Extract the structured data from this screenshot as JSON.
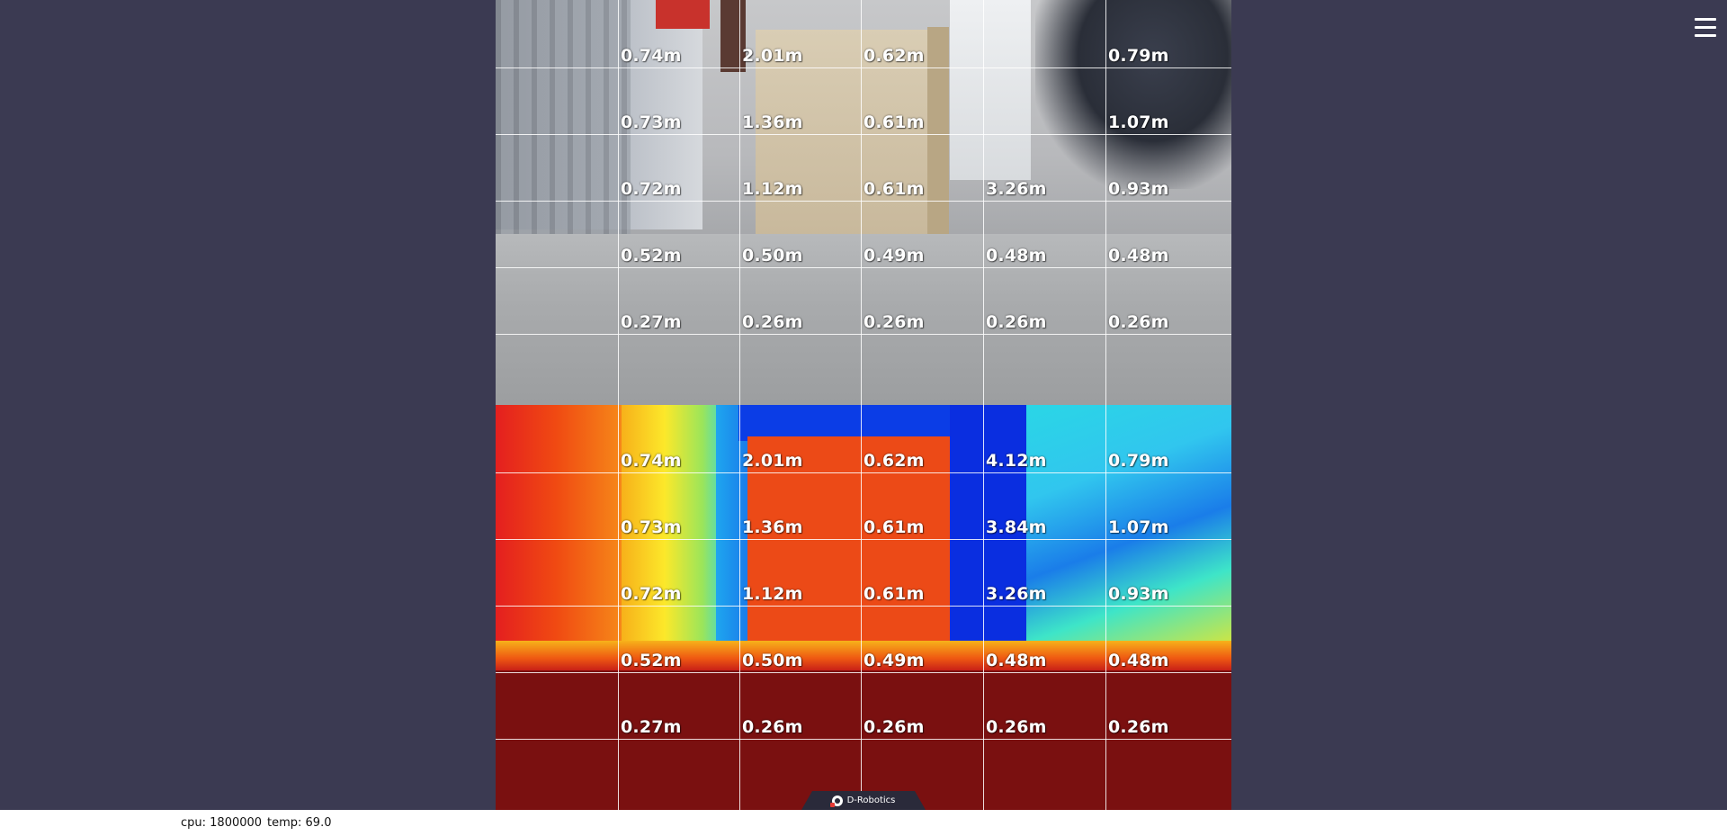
{
  "menu": {
    "icon": "hamburger-menu-icon"
  },
  "brand": {
    "name": "D-Robotics",
    "icon": "d-robotics-logo-icon"
  },
  "status": {
    "cpu": "cpu: 1800000",
    "temp": "temp: 69.0"
  },
  "camera": {
    "rows": [
      [
        "0.74m",
        "2.01m",
        "0.62m",
        "",
        "0.79m"
      ],
      [
        "0.73m",
        "1.36m",
        "0.61m",
        "",
        "1.07m"
      ],
      [
        "0.72m",
        "1.12m",
        "0.61m",
        "3.26m",
        "0.93m"
      ],
      [
        "0.52m",
        "0.50m",
        "0.49m",
        "0.48m",
        "0.48m"
      ],
      [
        "0.27m",
        "0.26m",
        "0.26m",
        "0.26m",
        "0.26m"
      ]
    ]
  },
  "depth": {
    "rows": [
      [
        "0.74m",
        "2.01m",
        "0.62m",
        "4.12m",
        "0.79m"
      ],
      [
        "0.73m",
        "1.36m",
        "0.61m",
        "3.84m",
        "1.07m"
      ],
      [
        "0.72m",
        "1.12m",
        "0.61m",
        "3.26m",
        "0.93m"
      ],
      [
        "0.52m",
        "0.50m",
        "0.49m",
        "0.48m",
        "0.48m"
      ],
      [
        "0.27m",
        "0.26m",
        "0.26m",
        "0.26m",
        "0.26m"
      ]
    ]
  },
  "colors": {
    "background": "#3b3a52",
    "grid": "#ffffff",
    "depth_near": "#7a1010",
    "depth_far": "#0a2ee0"
  }
}
